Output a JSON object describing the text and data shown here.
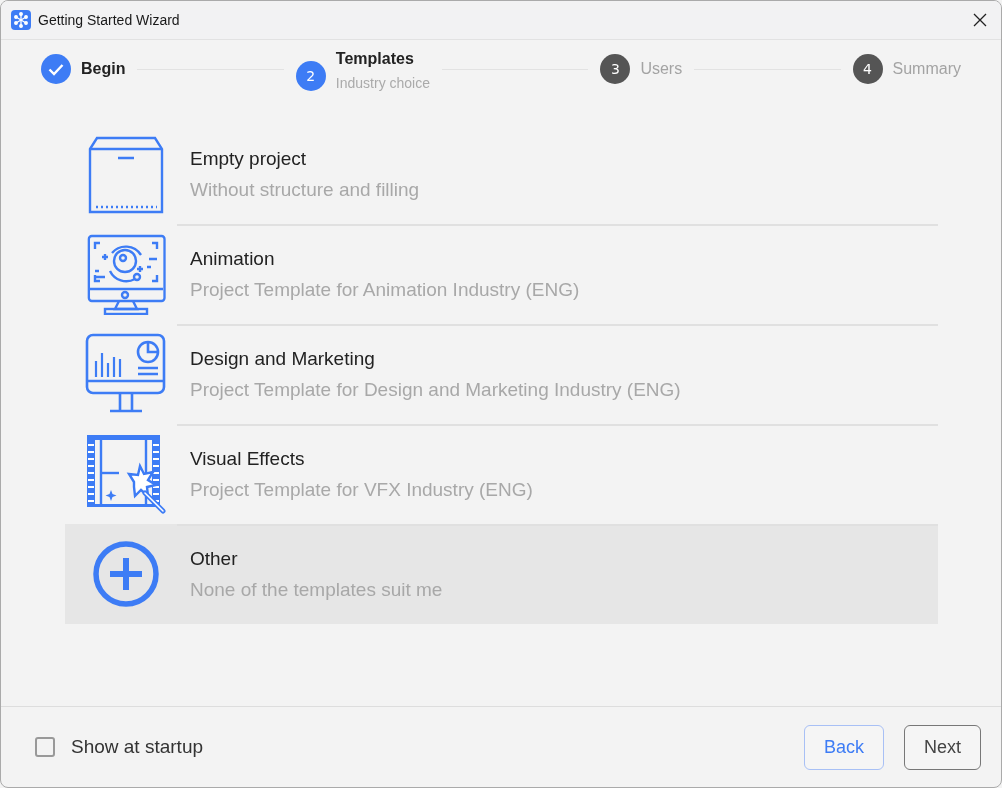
{
  "window": {
    "title": "Getting Started Wizard"
  },
  "steps": [
    {
      "label": "Begin",
      "done": true,
      "current": false
    },
    {
      "number": "2",
      "label": "Templates",
      "sublabel": "Industry choice",
      "done": false,
      "current": true
    },
    {
      "number": "3",
      "label": "Users",
      "done": false,
      "current": false
    },
    {
      "number": "4",
      "label": "Summary",
      "done": false,
      "current": false
    }
  ],
  "templates": [
    {
      "kind": "box",
      "title": "Empty project",
      "description": "Without structure and filling",
      "selected": false
    },
    {
      "kind": "animation",
      "title": "Animation",
      "description": "Project Template for Animation Industry (ENG)",
      "selected": false
    },
    {
      "kind": "chart",
      "title": "Design and Marketing",
      "description": "Project Template for Design and Marketing Industry (ENG)",
      "selected": false
    },
    {
      "kind": "vfx",
      "title": "Visual Effects",
      "description": "Project Template for VFX Industry (ENG)",
      "selected": false
    },
    {
      "kind": "plus",
      "title": "Other",
      "description": "None of the templates suit me",
      "selected": true
    }
  ],
  "show_at_startup": {
    "label": "Show at startup",
    "checked": false
  },
  "buttons": [
    {
      "label": "Back",
      "kind": "secondary"
    },
    {
      "label": "Next",
      "kind": "primary"
    }
  ]
}
